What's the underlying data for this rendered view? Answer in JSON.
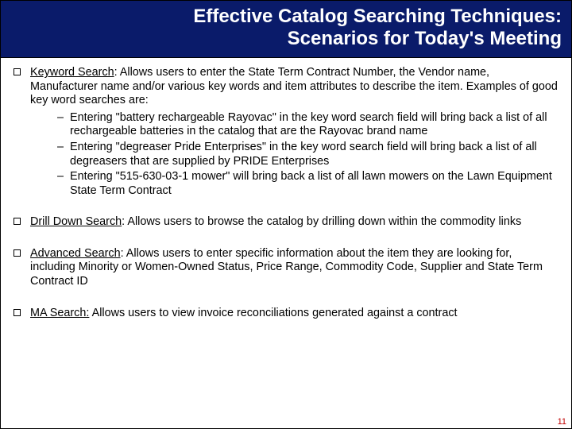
{
  "title_line1": "Effective Catalog Searching Techniques:",
  "title_line2": "Scenarios for Today's Meeting",
  "bullets": [
    {
      "label": "Keyword Search",
      "text": ": Allows users to enter the State Term Contract Number, the Vendor name, Manufacturer name and/or various key words and item attributes to describe the item.  Examples of good key word searches are:",
      "subs": [
        "Entering \"battery rechargeable Rayovac\" in the key word search field will bring back a list of all rechargeable batteries in the catalog that are the Rayovac brand name",
        "Entering \"degreaser Pride Enterprises\" in the key word search field will bring back a list of all degreasers that are supplied by PRIDE Enterprises",
        "Entering \"515-630-03-1 mower\" will bring back a list of all lawn mowers on the Lawn Equipment State Term Contract"
      ]
    },
    {
      "label": "Drill Down Search",
      "text": ": Allows users to browse the catalog by drilling down within the commodity links"
    },
    {
      "label": "Advanced Search",
      "text": ":  Allows users to enter specific information about the item they are looking for, including Minority or Women-Owned Status, Price Range, Commodity Code, Supplier and State Term Contract ID"
    },
    {
      "label": "MA Search:",
      "text": " Allows users to view invoice reconciliations generated against a contract"
    }
  ],
  "page_number": "11"
}
